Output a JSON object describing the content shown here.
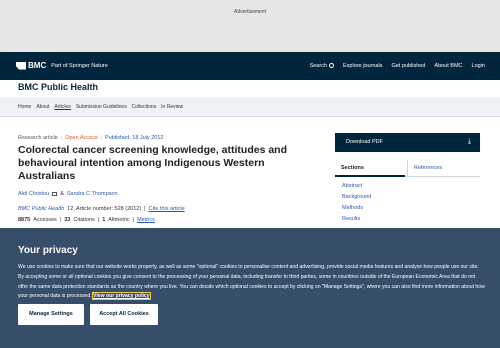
{
  "ad": {
    "label": "Advertisement"
  },
  "header": {
    "brand": "BMC",
    "tagline": "Part of Springer Nature",
    "nav": [
      "Search",
      "Explore journals",
      "Get published",
      "About BMC",
      "Login"
    ]
  },
  "journal": {
    "title": "BMC Public Health",
    "nav": [
      "Home",
      "About",
      "Articles",
      "Submission Guidelines",
      "Collections",
      "In Review"
    ]
  },
  "article": {
    "type": "Research article",
    "access": "Open Access",
    "published": "Published: 18 July 2012",
    "title": "Colorectal cancer screening knowledge, attitudes and behavioural intention among Indigenous Western Australians",
    "authors": [
      "Aldi Christou",
      "Sandra C Thompson"
    ],
    "author_sep": "&",
    "journal_name": "BMC Public Health",
    "cite_details": "12, Article number: 528 (2012)",
    "cite_link": "Cite this article",
    "accesses_count": "8875",
    "accesses_label": "Accesses",
    "citations_count": "33",
    "citations_label": "Citations",
    "altmetric_count": "1",
    "altmetric_label": "Altmetric",
    "metrics_link": "Metrics"
  },
  "sidebar": {
    "download_label": "Download PDF",
    "tabs": [
      "Sections",
      "References"
    ],
    "links": [
      "Abstract",
      "Background",
      "Methods",
      "Results"
    ]
  },
  "privacy": {
    "title": "Your privacy",
    "text": "We use cookies to make sure that our website works properly, as well as some \"optional\" cookies to personalise content and advertising, provide social media features and analyse how people use our site. By accepting some or all optional cookies you give consent to the processing of your personal data, including transfer to third parties, some in countries outside of the European Economic Area that do not offer the same data protection standards as the country where you live. You can decide which optional cookies to accept by clicking on \"Manage Settings\", where you can also find more information about how your personal data is processed.",
    "link": "View our privacy policy",
    "manage_label": "Manage Settings",
    "accept_label": "Accept All Cookies"
  }
}
